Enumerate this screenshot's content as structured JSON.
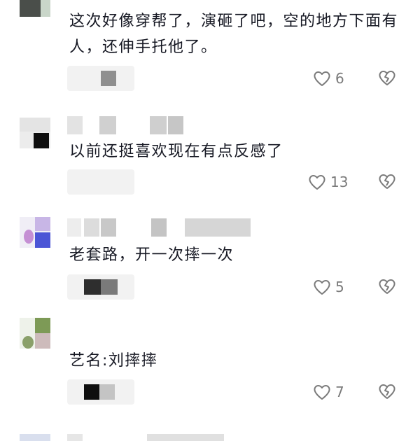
{
  "comments": [
    {
      "text": "这次好像穿帮了，演砸了吧，空的地方下面有人，还伸手托他了。",
      "likes": "6"
    },
    {
      "text": "以前还挺喜欢现在有点反感了",
      "likes": "13"
    },
    {
      "text": "老套路，开一次摔一次",
      "likes": "5"
    },
    {
      "text": "艺名:刘摔摔",
      "likes": "7"
    }
  ],
  "icons": {
    "like": "heart-outline-icon",
    "dislike": "broken-heart-icon"
  },
  "colors": {
    "text": "#161823",
    "meta": "#7a7a7a",
    "pill": "#f2f2f2"
  }
}
